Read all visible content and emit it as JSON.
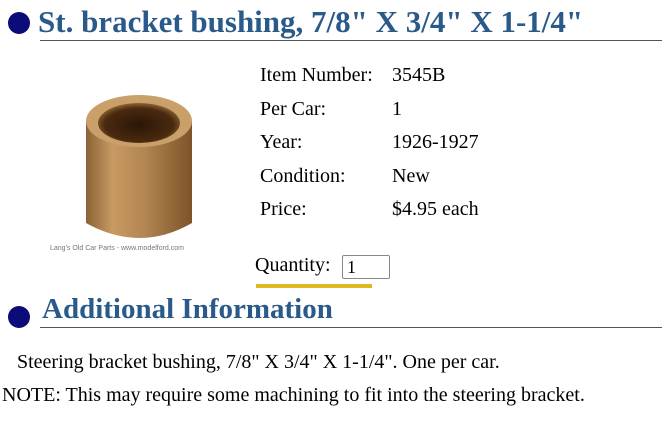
{
  "product": {
    "title": "St. bracket bushing, 7/8\" X 3/4\" X 1-1/4\"",
    "image_caption": "Lang's Old Car Parts - www.modelford.com",
    "details": [
      {
        "label": "Item Number:",
        "value": "3545B"
      },
      {
        "label": "Per Car:",
        "value": "1"
      },
      {
        "label": "Year:",
        "value": "1926-1927"
      },
      {
        "label": "Condition:",
        "value": "New"
      },
      {
        "label": "Price:",
        "value": "$4.95 each"
      }
    ],
    "quantity_label": "Quantity:",
    "quantity_value": "1"
  },
  "additional": {
    "title": "Additional Information",
    "description": "Steering bracket bushing, 7/8\" X 3/4\" X 1-1/4\". One per car.",
    "note": "NOTE: This may require some machining to fit into the steering bracket."
  },
  "colors": {
    "heading": "#2a5a8a",
    "bullet": "#0b0b7a",
    "bronze": "#b58a55",
    "accent_underline": "#e0b820"
  },
  "icons": {
    "bullet": "filled-circle",
    "product": "bronze-bushing"
  }
}
